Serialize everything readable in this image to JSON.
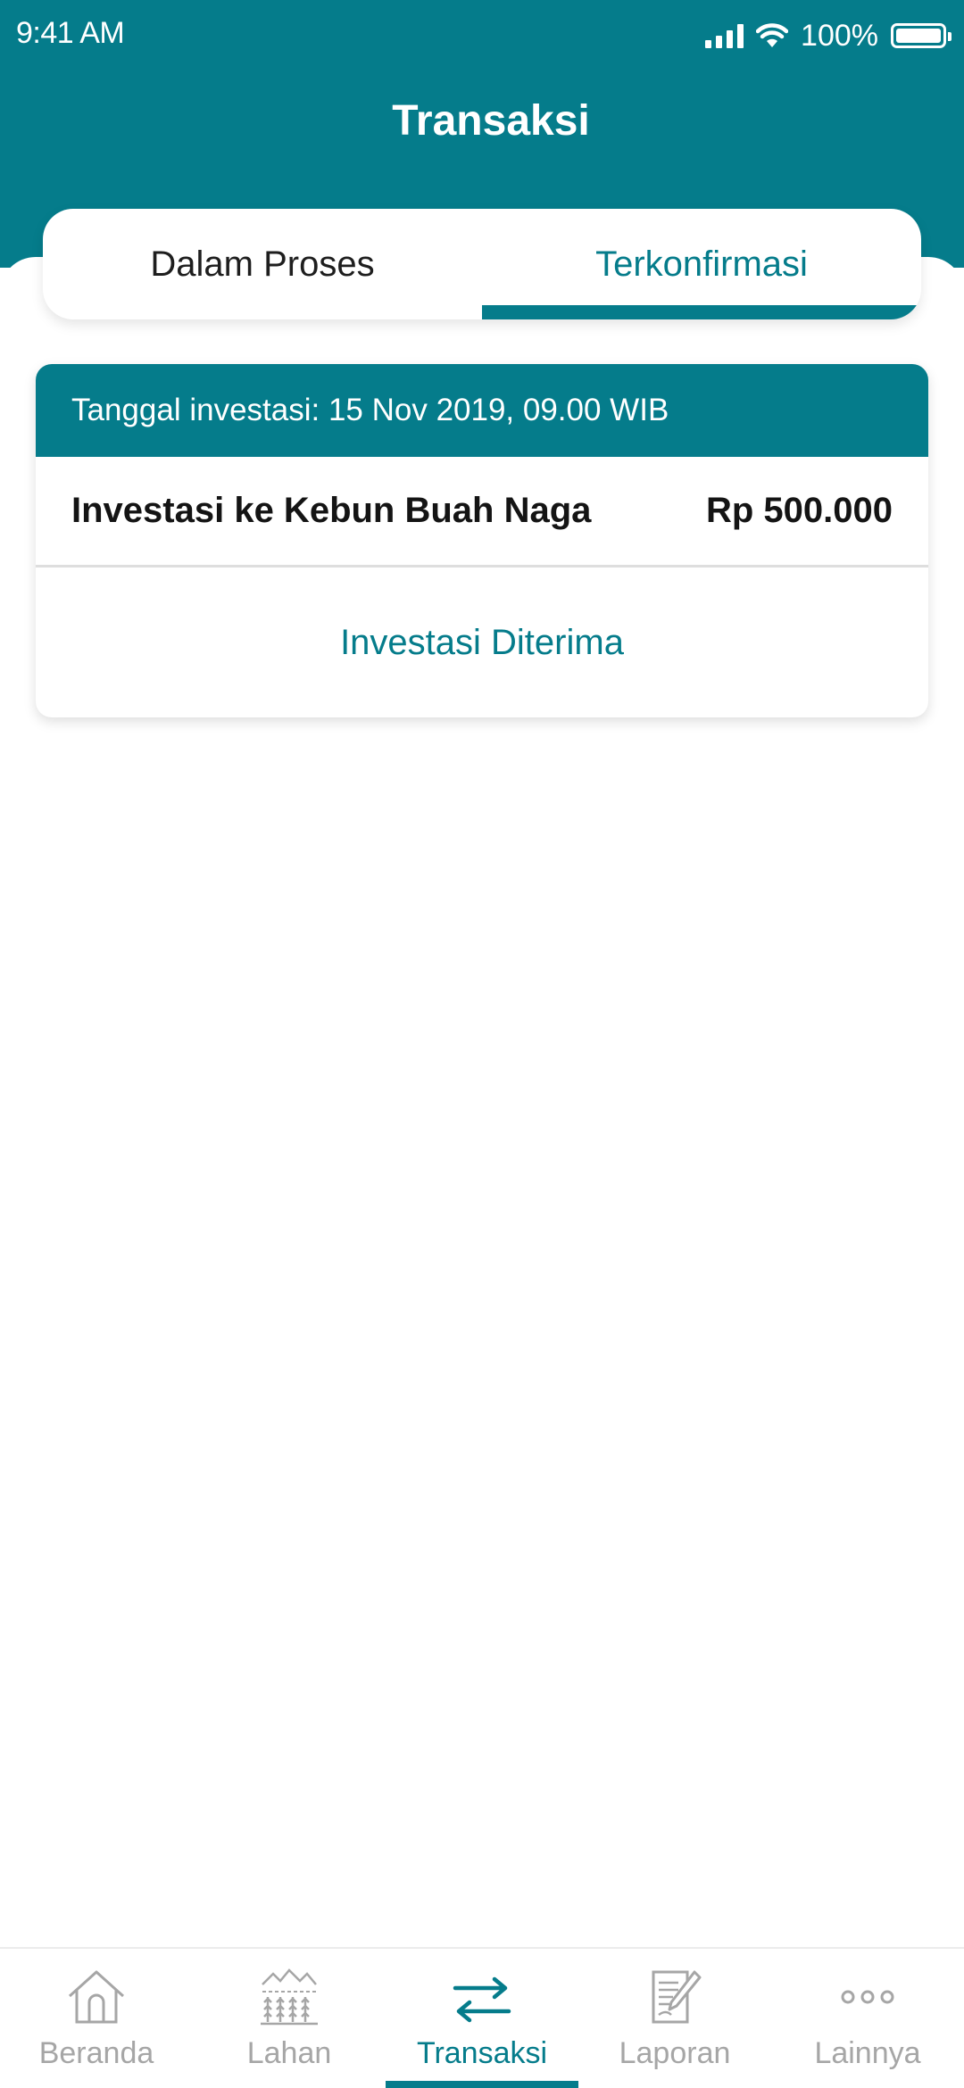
{
  "status_bar": {
    "time": "9:41 AM",
    "battery_percent": "100%",
    "icons": [
      "cellular-signal-icon",
      "wifi-icon",
      "battery-icon"
    ]
  },
  "header": {
    "title": "Transaksi"
  },
  "tabs": [
    {
      "label": "Dalam Proses",
      "active": false
    },
    {
      "label": "Terkonfirmasi",
      "active": true
    }
  ],
  "transaction": {
    "date_label": "Tanggal investasi: 15 Nov 2019, 09.00 WIB",
    "description": "Investasi ke Kebun Buah Naga",
    "amount": "Rp 500.000",
    "status": "Investasi Diterima"
  },
  "bottom_nav": [
    {
      "label": "Beranda",
      "icon": "home-icon",
      "active": false
    },
    {
      "label": "Lahan",
      "icon": "field-icon",
      "active": false
    },
    {
      "label": "Transaksi",
      "icon": "transfer-arrows-icon",
      "active": true
    },
    {
      "label": "Laporan",
      "icon": "report-icon",
      "active": false
    },
    {
      "label": "Lainnya",
      "icon": "more-icon",
      "active": false
    }
  ],
  "colors": {
    "primary": "#057C8B",
    "inactive": "#A6A6A6",
    "text": "#1E1E1E"
  }
}
